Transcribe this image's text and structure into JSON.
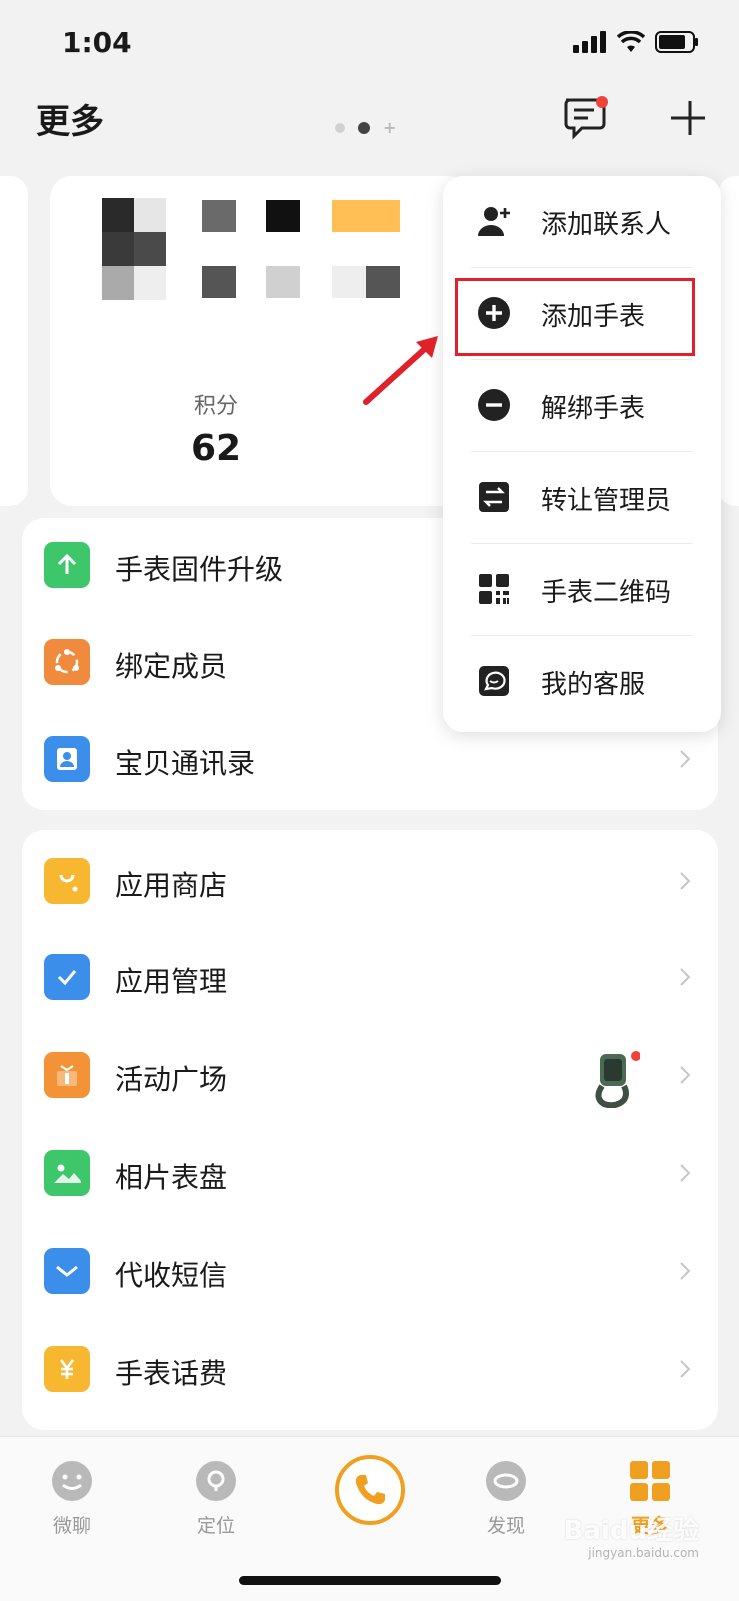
{
  "status_bar": {
    "time": "1:04"
  },
  "header": {
    "title": "更多"
  },
  "points": {
    "label": "积分",
    "value": "62"
  },
  "device_list": {
    "items": [
      {
        "label": "手表固件升级",
        "icon": "arrow-up-icon",
        "color": "#3ec66a"
      },
      {
        "label": "绑定成员",
        "icon": "members-icon",
        "color": "#f08a3c"
      },
      {
        "label": "宝贝通讯录",
        "icon": "contacts-icon",
        "color": "#3b8eea"
      }
    ]
  },
  "app_list": {
    "items": [
      {
        "label": "应用商店",
        "icon": "shop-bag-icon",
        "color": "#f7b731"
      },
      {
        "label": "应用管理",
        "icon": "check-icon",
        "color": "#3b8eea"
      },
      {
        "label": "活动广场",
        "icon": "gift-icon",
        "color": "#f39237"
      },
      {
        "label": "相片表盘",
        "icon": "photo-icon",
        "color": "#3ec66a"
      },
      {
        "label": "代收短信",
        "icon": "mail-icon",
        "color": "#3b8eea"
      },
      {
        "label": "手表话费",
        "icon": "yuan-icon",
        "color": "#f7b731"
      }
    ]
  },
  "dropdown": {
    "items": [
      {
        "label": "添加联系人",
        "icon": "add-contact-icon"
      },
      {
        "label": "添加手表",
        "icon": "plus-circle-icon"
      },
      {
        "label": "解绑手表",
        "icon": "minus-circle-icon"
      },
      {
        "label": "转让管理员",
        "icon": "transfer-icon"
      },
      {
        "label": "手表二维码",
        "icon": "qr-code-icon"
      },
      {
        "label": "我的客服",
        "icon": "service-icon"
      }
    ]
  },
  "tabbar": {
    "tabs": [
      {
        "label": "微聊",
        "icon": "chat-face-icon"
      },
      {
        "label": "定位",
        "icon": "location-icon"
      },
      {
        "label": "",
        "icon": "phone-icon"
      },
      {
        "label": "发现",
        "icon": "discover-icon"
      },
      {
        "label": "更多",
        "icon": "more-grid-icon"
      }
    ],
    "active_color": "#f0a020"
  },
  "watermark": {
    "text": "Baidu经验",
    "sub": "jingyan.baidu.com"
  }
}
